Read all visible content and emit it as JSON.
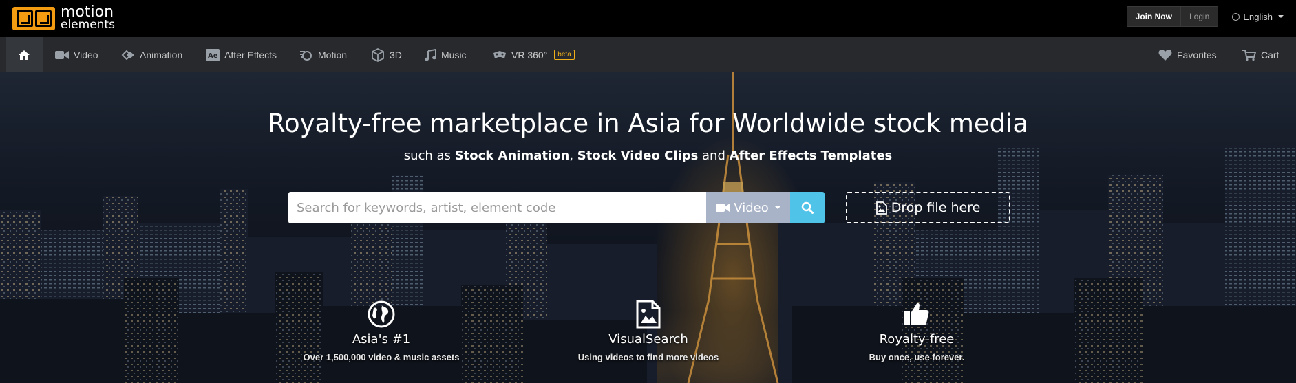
{
  "brand": {
    "name_line1": "motion",
    "name_line2": "elements"
  },
  "topbar": {
    "join_label": "Join Now",
    "login_label": "Login",
    "language": "English"
  },
  "nav": {
    "items": [
      {
        "label": "Video",
        "icon": "video-camera-icon"
      },
      {
        "label": "Animation",
        "icon": "animation-icon"
      },
      {
        "label": "After Effects",
        "icon": "after-effects-icon"
      },
      {
        "label": "Motion",
        "icon": "motion-icon"
      },
      {
        "label": "3D",
        "icon": "cube-icon"
      },
      {
        "label": "Music",
        "icon": "music-note-icon"
      },
      {
        "label": "VR 360°",
        "icon": "vr-icon",
        "badge": "beta"
      }
    ],
    "favorites_label": "Favorites",
    "cart_label": "Cart"
  },
  "hero": {
    "title": "Royalty-free marketplace in Asia for Worldwide stock media",
    "sub_prefix": "such as",
    "sub_item1": "Stock Animation",
    "sub_sep1": ",",
    "sub_item2": "Stock Video Clips",
    "sub_and": "and",
    "sub_item3": "After Effects Templates"
  },
  "search": {
    "placeholder": "Search for keywords, artist, element code",
    "type_selected": "Video",
    "drop_label": "Drop file here"
  },
  "features": [
    {
      "title": "Asia's #1",
      "desc": "Over 1,500,000 video & music assets",
      "icon": "globe-icon"
    },
    {
      "title": "VisualSearch",
      "desc": "Using videos to find more videos",
      "icon": "image-file-icon"
    },
    {
      "title": "Royalty-free",
      "desc": "Buy once, use forever.",
      "icon": "thumbs-up-icon"
    }
  ],
  "colors": {
    "logo_orange": "#f39c12",
    "search_button": "#4fc3e8",
    "type_select": "#a9b3c8",
    "beta_badge": "#f1b01a",
    "navbar": "#27292d"
  }
}
